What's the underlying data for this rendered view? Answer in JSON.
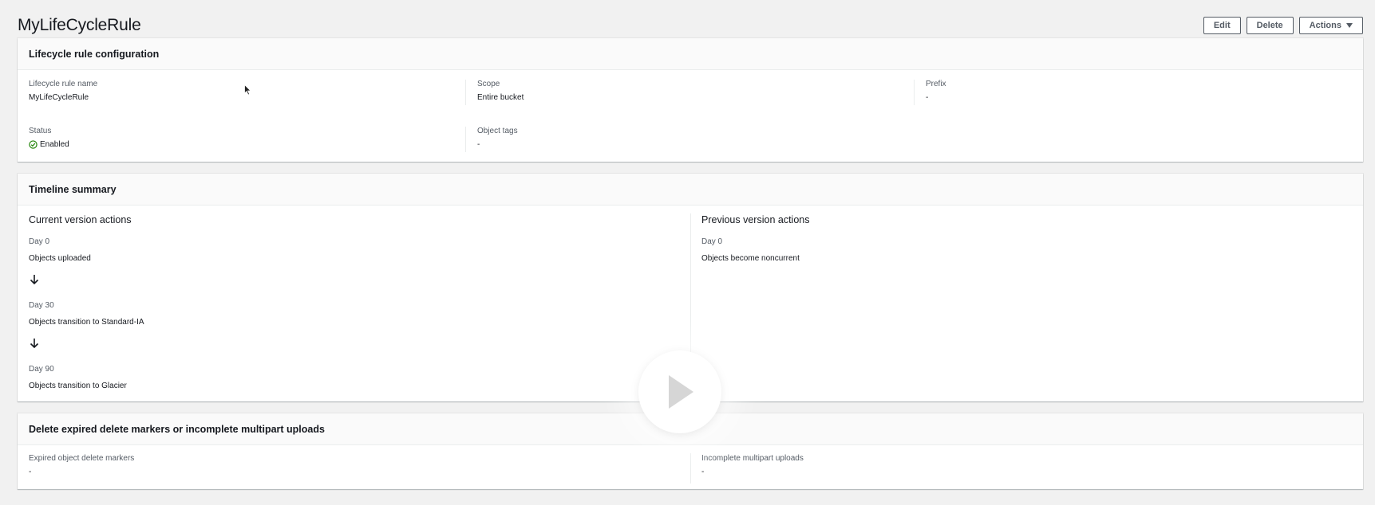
{
  "page_title": "MyLifeCycleRule",
  "buttons": {
    "edit": "Edit",
    "delete": "Delete",
    "actions": "Actions"
  },
  "config_panel": {
    "title": "Lifecycle rule configuration",
    "rule_name_label": "Lifecycle rule name",
    "rule_name_value": "MyLifeCycleRule",
    "scope_label": "Scope",
    "scope_value": "Entire bucket",
    "prefix_label": "Prefix",
    "prefix_value": "-",
    "status_label": "Status",
    "status_value": "Enabled",
    "object_tags_label": "Object tags",
    "object_tags_value": "-"
  },
  "timeline": {
    "title": "Timeline summary",
    "current": {
      "title": "Current version actions",
      "steps": [
        {
          "day": "Day 0",
          "event": "Objects uploaded"
        },
        {
          "day": "Day 30",
          "event": "Objects transition to Standard-IA"
        },
        {
          "day": "Day 90",
          "event": "Objects transition to Glacier"
        }
      ]
    },
    "previous": {
      "title": "Previous version actions",
      "steps": [
        {
          "day": "Day 0",
          "event": "Objects become noncurrent"
        }
      ]
    }
  },
  "delete_panel": {
    "title": "Delete expired delete markers or incomplete multipart uploads",
    "expired_label": "Expired object delete markers",
    "expired_value": "-",
    "incomplete_label": "Incomplete multipart uploads",
    "incomplete_value": "-"
  },
  "colors": {
    "success": "#1d8102",
    "text": "#16191f",
    "muted": "#545b64",
    "background": "#f1f1f1"
  },
  "icons": {
    "status": "check-circle-icon",
    "arrow": "arrow-down-icon",
    "play": "play-icon",
    "cursor": "mouse-cursor-icon"
  }
}
